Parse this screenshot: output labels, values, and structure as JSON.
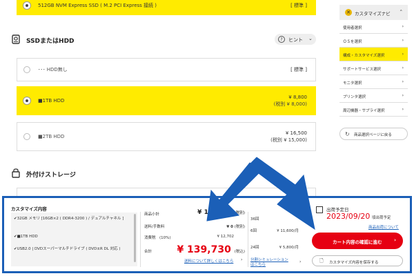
{
  "options_top": {
    "ssd_selected_label": "512GB NVM Express SSD ( M.2 PCI Express 接続 )",
    "ssd_selected_tag": "[ 標準 ]"
  },
  "ssd_hdd_section": {
    "title": "SSDまたはHDD",
    "hint_label": "ヒント",
    "hint_icon": "question-icon",
    "options": [
      {
        "label": "･･･ HDD無し",
        "tag": "[ 標準 ]",
        "selected": false
      },
      {
        "label": "■1TB HDD",
        "price": "¥ 8,800",
        "price_sub": "(税別 ¥ 8,000)",
        "selected": true
      },
      {
        "label": "■2TB HDD",
        "price": "¥ 16,500",
        "price_sub": "(税別 ¥ 15,000)",
        "selected": false
      }
    ]
  },
  "external_storage_section": {
    "title": "外付けストレージ"
  },
  "nav": {
    "header": "カスタマイズナビ",
    "items": [
      {
        "label": "使用者選択",
        "active": false
      },
      {
        "label": "ＯＳを選択",
        "active": false
      },
      {
        "label": "構成・カスタマイズ選択",
        "active": true
      },
      {
        "label": "サポートサービス選択",
        "active": false
      },
      {
        "label": "モニタ選択",
        "active": false
      },
      {
        "label": "プリンタ選択",
        "active": false
      },
      {
        "label": "周辺機器・サプライ選択",
        "active": false
      }
    ],
    "back_label": "商品選択ページに戻る"
  },
  "summary": {
    "title": "カスタマイズ内容",
    "spec_items": [
      "32GB メモリ [16GB×2 ( DDR4-3200 ) / デュアルチャネル ]",
      "■1TB HDD",
      "USB2.0 | DVDスーパーマルチドライブ ( DVD±R DL 対応 )"
    ],
    "subtotal_label": "商品小計",
    "subtotal_value": "¥ 127,028",
    "subtotal_tax": "(税別)",
    "shipping_label": "送料/手数料",
    "shipping_value": "¥ 0",
    "shipping_tax": "(税別)",
    "tax_label": "消費税　(10%)",
    "tax_value": "¥ 12,702",
    "total_label": "合計",
    "total_value": "¥ 139,730",
    "total_tax": "(税込)",
    "shipping_detail_link": "送料について詳しくはこちら",
    "installment_header": "36回",
    "installment_rows": [
      {
        "label": "6回",
        "value": "¥ 11,600/月"
      },
      {
        "label": "24回",
        "value": "¥ 5,800/月"
      }
    ],
    "installment_link_line1": "分割シミュレーション",
    "installment_link_line2": "はこちら",
    "ship_label": "出荷予定日",
    "ship_date": "2023/09/20",
    "ship_date_note": "頃出荷予定",
    "ship_link": "商品出荷について",
    "cart_button": "カート内容の確認に進む",
    "save_button": "カスタマイズ内容を保存する"
  },
  "colors": {
    "accent_yellow": "#ffeb00",
    "price_red": "#e60012",
    "frame_blue": "#1b5fb7"
  }
}
